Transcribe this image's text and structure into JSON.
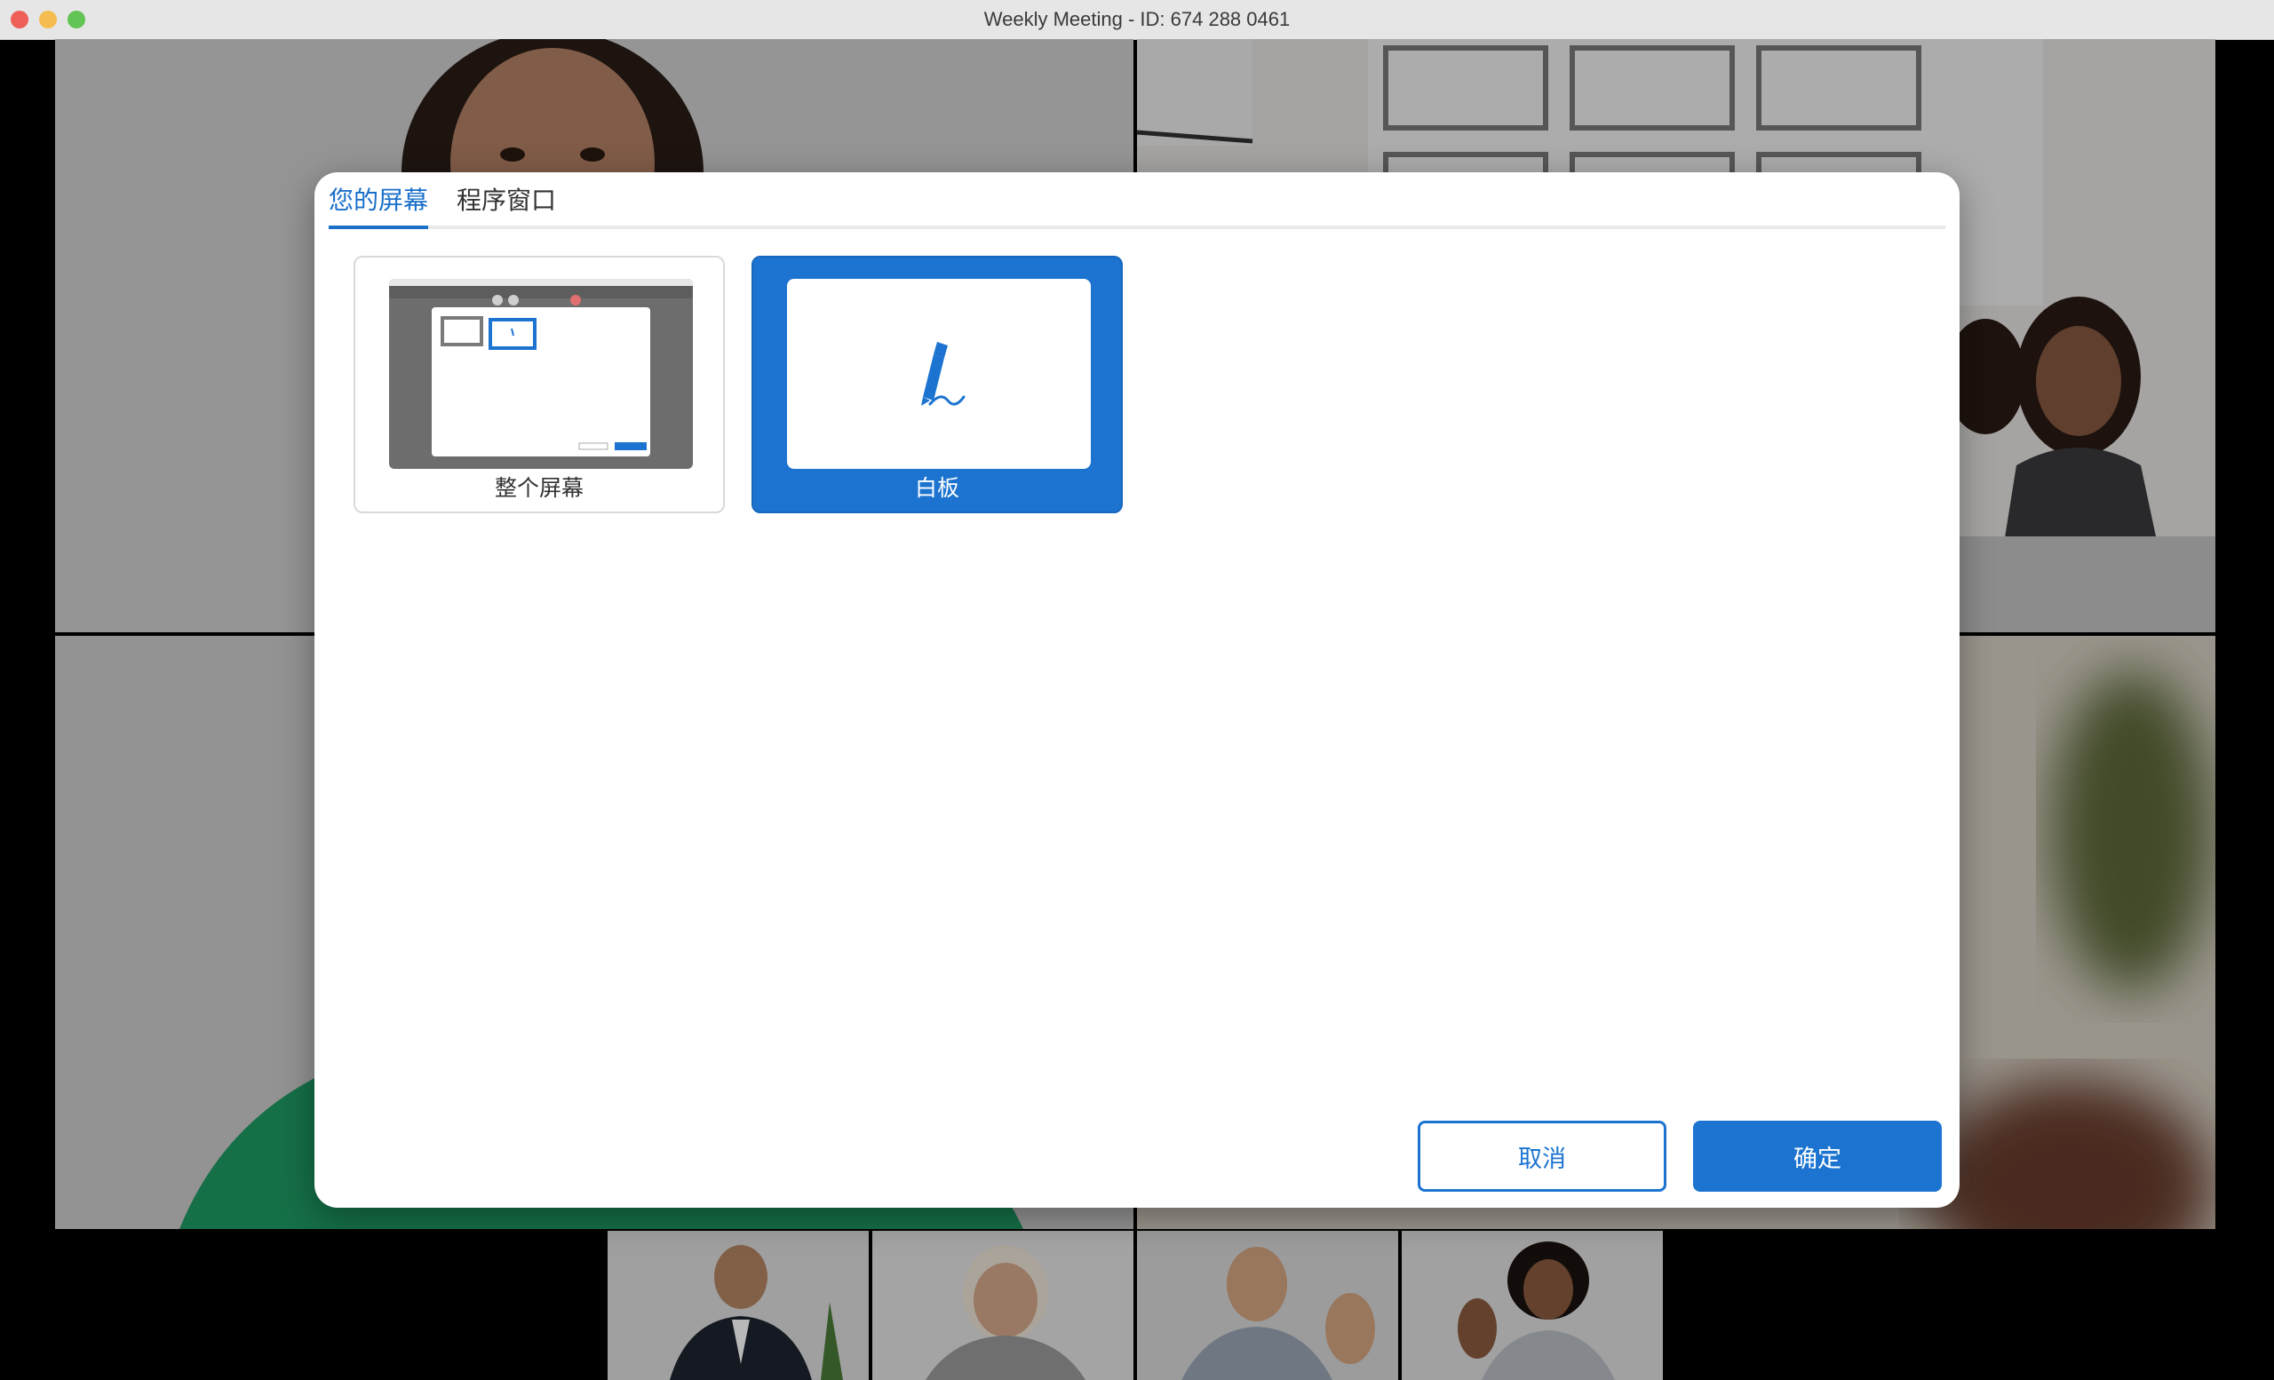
{
  "window": {
    "title": "Weekly Meeting -  ID: 674 288 0461"
  },
  "dialog": {
    "tabs": [
      {
        "label": "您的屏幕",
        "active": true
      },
      {
        "label": "程序窗口",
        "active": false
      }
    ],
    "options": [
      {
        "label": "整个屏幕",
        "selected": false
      },
      {
        "label": "白板",
        "selected": true
      }
    ],
    "cancel_label": "取消",
    "ok_label": "确定"
  },
  "colors": {
    "accent": "#1c74d0",
    "tab_active": "#1a6fc9"
  }
}
